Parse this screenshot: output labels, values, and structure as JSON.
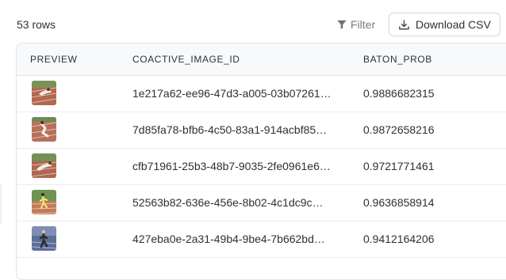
{
  "toolbar": {
    "row_count": "53 rows",
    "filter_label": "Filter",
    "download_label": "Download CSV"
  },
  "table": {
    "columns": [
      "PREVIEW",
      "COACTIVE_IMAGE_ID",
      "BATON_PROB"
    ],
    "rows": [
      {
        "id": "1e217a62-ee96-47d3-a005-03b07261…",
        "prob": "0.9886682315"
      },
      {
        "id": "7d85fa78-bfb6-4c50-83a1-914acbf85…",
        "prob": "0.9872658216"
      },
      {
        "id": "cfb71961-25b3-48b7-9035-2fe0961e6…",
        "prob": "0.9721771461"
      },
      {
        "id": "52563b82-636e-456e-8b02-4c1dc9c…",
        "prob": "0.9636858914"
      },
      {
        "id": "427eba0e-2a31-49b4-9be4-7b662bd…",
        "prob": "0.9412164206"
      }
    ]
  }
}
